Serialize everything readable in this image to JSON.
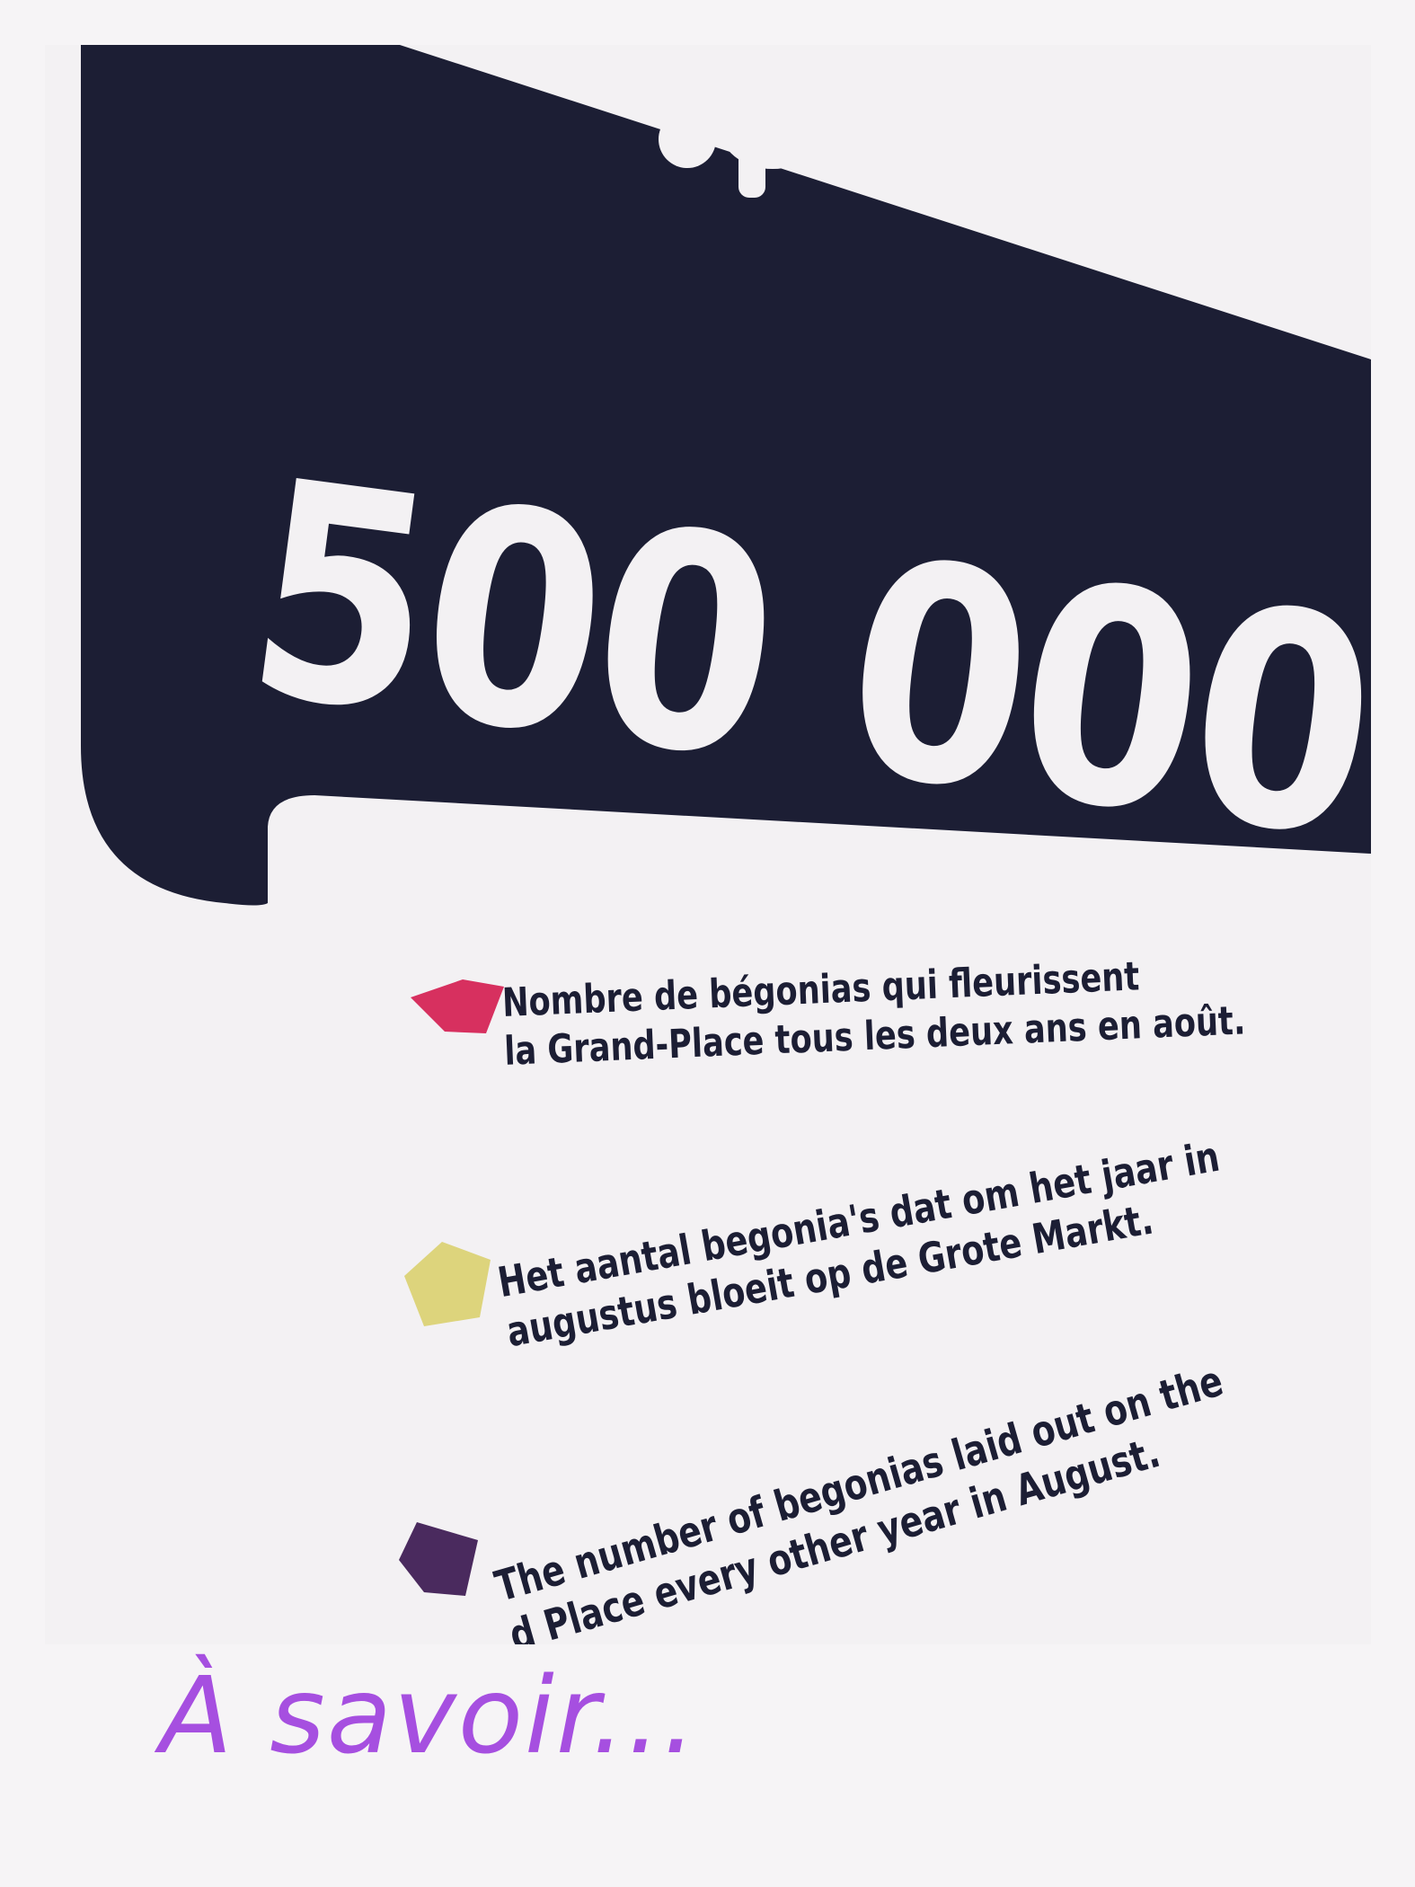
{
  "sign": {
    "number": "500 000",
    "paragraphs": [
      {
        "lines": [
          "Nombre de bégonias qui fleurissent",
          "la Grand-Place tous les deux ans en août."
        ],
        "marker_color": "#d7305f"
      },
      {
        "lines": [
          "Het aantal begonia's dat om het jaar in",
          "augustus bloeit op de Grote Markt."
        ],
        "marker_color": "#ddd47c"
      },
      {
        "lines": [
          "The number of begonias laid out on the",
          "d Place every other year in August."
        ],
        "marker_color": "#4a2a5e"
      }
    ]
  },
  "caption": "À savoir...",
  "colors": {
    "panel": "#1c1e34",
    "background": "#f3f1f3",
    "caption": "#a64fe0"
  }
}
